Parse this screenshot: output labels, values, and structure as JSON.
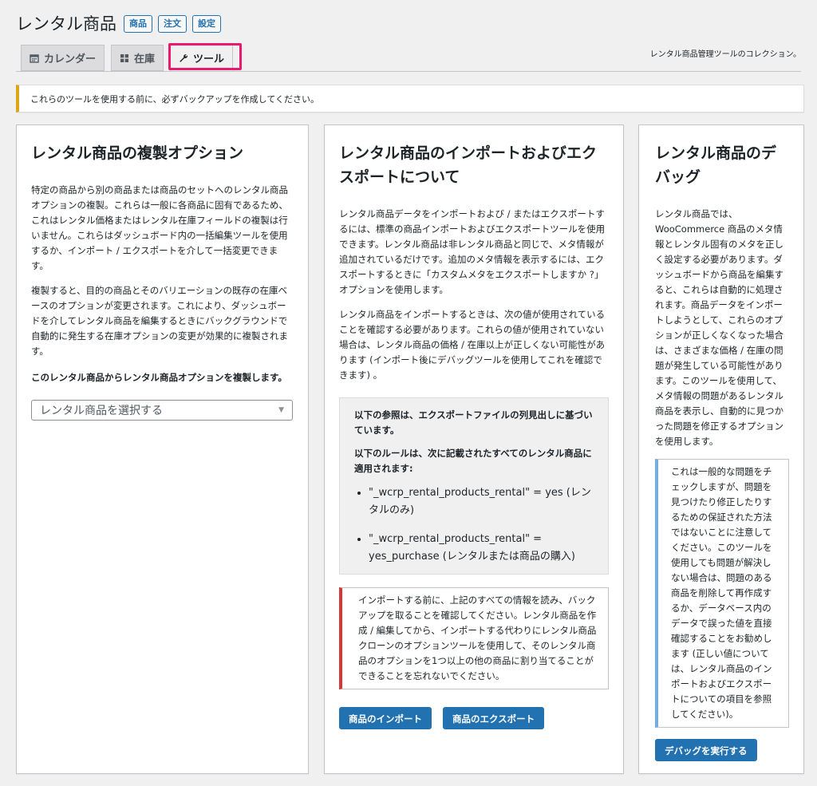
{
  "header": {
    "title": "レンタル商品",
    "links": [
      "商品",
      "注文",
      "設定"
    ],
    "description": "レンタル商品管理ツールのコレクション。"
  },
  "tabs": [
    {
      "label": "カレンダー",
      "icon": "calendar-icon"
    },
    {
      "label": "在庫",
      "icon": "grid-icon"
    },
    {
      "label": "ツール",
      "icon": "wrench-icon",
      "active": true
    }
  ],
  "notice": "これらのツールを使用する前に、必ずバックアップを作成してください。",
  "clone": {
    "title": "レンタル商品の複製オプション",
    "p1": "特定の商品から別の商品または商品のセットへのレンタル商品オプションの複製。これらは一般に各商品に固有であるため、これはレンタル価格またはレンタル在庫フィールドの複製は行いません。これらはダッシュボード内の一括編集ツールを使用するか、インポート / エクスポートを介して一括変更できます。",
    "p2": "複製すると、目的の商品とそのバリエーションの既存の在庫ベースのオプションが変更されます。これにより、ダッシュボードを介してレンタル商品を編集するときにバックグラウンドで自動的に発生する在庫オプションの変更が効果的に複製されます。",
    "label": "このレンタル商品からレンタル商品オプションを複製します。",
    "select_value": "レンタル商品を選択する"
  },
  "import": {
    "title": "レンタル商品のインポートおよびエクスポートについて",
    "p1": "レンタル商品データをインポートおよび / またはエクスポートするには、標準の商品インポートおよびエクスポートツールを使用できます。レンタル商品は非レンタル商品と同じで、メタ情報が追加されているだけです。追加のメタ情報を表示するには、エクスポートするときに「カスタムメタをエクスポートしますか ?」オプションを使用します。",
    "p2": "レンタル商品をインポートするときは、次の値が使用されていることを確認する必要があります。これらの値が使用されていない場合は、レンタル商品の価格 / 在庫以上が正しくない可能性があります (インポート後にデバッグツールを使用してこれを確認できます) 。",
    "info1": "以下の参照は、エクスポートファイルの列見出しに基づいています。",
    "info2": "以下のルールは、次に記載されたすべてのレンタル商品に適用されます:",
    "rules": [
      "\"_wcrp_rental_products_rental\" = yes (レンタルのみ)",
      "\"_wcrp_rental_products_rental\" = yes_purchase (レンタルまたは商品の購入)"
    ],
    "warning": "インポートする前に、上記のすべての情報を読み、バックアップを取ることを確認してください。レンタル商品を作成 / 編集してから、インポートする代わりにレンタル商品クローンのオプションツールを使用して、そのレンタル商品のオプションを1つ以上の他の商品に割り当てることができることを忘れないでください。",
    "import_button": "商品のインポート",
    "export_button": "商品のエクスポート"
  },
  "debug": {
    "title": "レンタル商品のデバッグ",
    "p1": "レンタル商品では、WooCommerce 商品のメタ情報とレンタル固有のメタを正しく設定する必要があります。ダッシュボードから商品を編集すると、これらは自動的に処理されます。商品データをインポートしようとして、これらのオプションが正しくなくなった場合は、さまざまな価格 / 在庫の問題が発生している可能性があります。このツールを使用して、メタ情報の問題があるレンタル商品を表示し、自動的に見つかった問題を修正するオプションを使用します。",
    "note": "これは一般的な問題をチェックしますが、問題を見つけたり修正したりするための保証された方法ではないことに注意してください。このツールを使用しても問題が解決しない場合は、問題のある商品を削除して再作成するか、データベース内のデータで誤った値を直接確認することをお勧めします (正しい値については、レンタル商品のインポートおよびエクスポートについての項目を参照してください)。",
    "button": "デバッグを実行する"
  },
  "colors": {
    "accent": "#2271b1",
    "highlight": "#e8196e",
    "notice_border": "#dba617",
    "warning_border": "#d63638",
    "note_border": "#72aee6"
  }
}
